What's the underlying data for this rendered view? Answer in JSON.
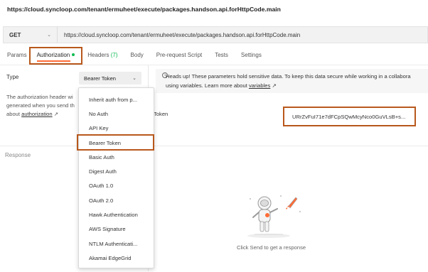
{
  "page": {
    "url": "https://cloud.syncloop.com/tenant/ermuheet/execute/packages.handson.api.forHttpCode.main"
  },
  "request": {
    "method": "GET",
    "url": "https://cloud.syncloop.com/tenant/ermuheet/execute/packages.handson.api.forHttpCode.main"
  },
  "tabs": [
    {
      "label": "Params"
    },
    {
      "label": "Authorization",
      "active": true
    },
    {
      "label": "Headers",
      "count": "(7)"
    },
    {
      "label": "Body"
    },
    {
      "label": "Pre-request Script"
    },
    {
      "label": "Tests"
    },
    {
      "label": "Settings"
    }
  ],
  "auth": {
    "type_label": "Type",
    "selected_type": "Bearer Token",
    "help_line1": "The authorization header wi",
    "help_line2": "generated when you send th",
    "help_line3_prefix": "about ",
    "help_link": "authorization",
    "help_arrow": "↗",
    "notice_text": "Heads up! These parameters hold sensitive data. To keep this data secure while working in a collabora",
    "notice_line2_prefix": "using variables. Learn more about ",
    "notice_link": "variables",
    "notice_arrow": "↗",
    "token_label": "Token",
    "token_value": "URrZvFuI71e7dFCpSQwMcyNco0GuVLsB+s..."
  },
  "dropdown": {
    "items": [
      "Inherit auth from p...",
      "No Auth",
      "API Key",
      "Bearer Token",
      "Basic Auth",
      "Digest Auth",
      "OAuth 1.0",
      "OAuth 2.0",
      "Hawk Authentication",
      "AWS Signature",
      "NTLM Authenticati...",
      "Akamai EdgeGrid"
    ]
  },
  "response": {
    "label": "Response",
    "hint": "Click Send to get a response"
  },
  "colors": {
    "accent": "#ff6c37",
    "highlight_border": "#b8581c",
    "status_dot": "#0cbb52"
  }
}
